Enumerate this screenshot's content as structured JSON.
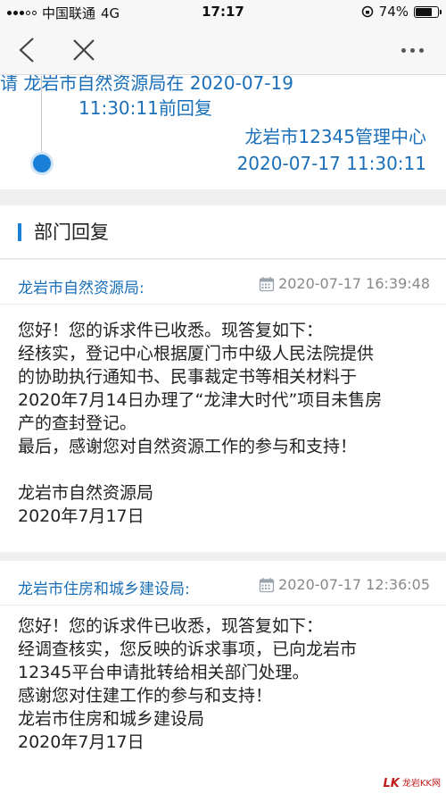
{
  "status_bar": {
    "carrier": "中国联通",
    "network": "4G",
    "time": "17:17",
    "battery": "74%",
    "battery_level": 0.74
  },
  "nav": {
    "back_icon": "chevron-left-icon",
    "close_icon": "close-icon",
    "more_icon": "more-icon"
  },
  "timeline": {
    "line1": "请 龙岩市自然资源局在 2020-07-19",
    "line2": "11:30:11前回复",
    "source": "龙岩市12345管理中心",
    "timestamp": "2020-07-17 11:30:11"
  },
  "section": {
    "title": "部门回复"
  },
  "replies": [
    {
      "dept": "龙岩市自然资源局:",
      "date": "2020-07-17 16:39:48",
      "lines": [
        "您好！您的诉求件已收悉。现答复如下：",
        "经核实，登记中心根据厦门市中级人民法院提供",
        "的协助执行通知书、民事裁定书等相关材料于",
        "2020年7月14日办理了“龙津大时代”项目未售房",
        "产的查封登记。",
        "最后，感谢您对自然资源工作的参与和支持！",
        "",
        "龙岩市自然资源局",
        "2020年7月17日"
      ]
    },
    {
      "dept": "龙岩市住房和城乡建设局:",
      "date": "2020-07-17 12:36:05",
      "lines": [
        "您好！您的诉求件已收悉，现答复如下：",
        " 经调查核实，您反映的诉求事项，已向龙岩市",
        "12345平台申请批转给相关部门处理。",
        "感谢您对住建工作的参与和支持！",
        "龙岩市住房和城乡建设局",
        "2020年7月17日"
      ]
    }
  ],
  "watermark": {
    "logo": "LK",
    "text": "龙岩KK网"
  },
  "colors": {
    "accent": "#1a7fd6",
    "link": "#1a6fb8"
  }
}
